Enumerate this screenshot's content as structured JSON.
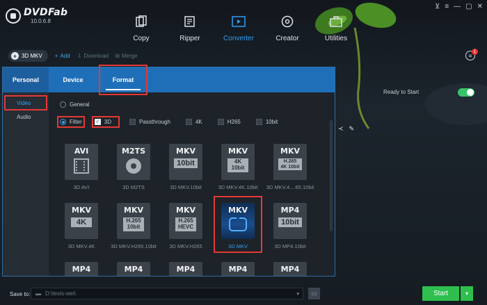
{
  "app": {
    "name": "DVDFab",
    "version": "10.0.6.8"
  },
  "window_controls": [
    "pin-icon",
    "menu-icon",
    "minimize-icon",
    "maximize-icon",
    "close-icon"
  ],
  "modules": [
    {
      "label": "Copy",
      "icon": "copy-icon"
    },
    {
      "label": "Ripper",
      "icon": "ripper-icon"
    },
    {
      "label": "Converter",
      "icon": "converter-icon",
      "active": true
    },
    {
      "label": "Creator",
      "icon": "creator-icon"
    },
    {
      "label": "Utilities",
      "icon": "utilities-icon"
    }
  ],
  "toolbar": {
    "mode": "3D MKV",
    "add": "Add",
    "download": "Download",
    "merge": "Merge"
  },
  "task_badge": "1",
  "background": {
    "ready_label": "Ready to Start"
  },
  "popup": {
    "tabs": {
      "personal": "Personal",
      "device": "Device",
      "format": "Format"
    },
    "side": {
      "video": "Video",
      "audio": "Audio"
    },
    "general": "General",
    "filter": "Filter",
    "options": {
      "three_d": "3D",
      "passthrough": "Passthrough",
      "four_k": "4K",
      "h265": "H265",
      "tenbit": "10bit"
    },
    "formats": [
      {
        "t1": "AVI",
        "cap": "3D AVI"
      },
      {
        "t1": "M2TS",
        "cap": "3D M2TS"
      },
      {
        "t1": "MKV",
        "t2": "10bit",
        "cap": "3D MKV.10bit"
      },
      {
        "t1": "MKV",
        "t2": "4K\n10bit",
        "cap": "3D MKV.4K.10bit"
      },
      {
        "t1": "MKV",
        "t2": "H.265\n4K 10bit",
        "cap": "3D MKV.4....65.10bit"
      },
      {
        "t1": "MKV",
        "t2": "4K",
        "cap": "3D MKV.4K"
      },
      {
        "t1": "MKV",
        "t2": "H.265\n10bit",
        "cap": "3D MKV.H265.10bit"
      },
      {
        "t1": "MKV",
        "t2": "H.265\nHEVC",
        "cap": "3D MKV.H265"
      },
      {
        "t1": "MKV",
        "cap": "3D MKV"
      },
      {
        "t1": "MP4",
        "t2": "10bit",
        "cap": "3D MP4.10bit"
      },
      {
        "t1": "MP4"
      },
      {
        "t1": "MP4"
      },
      {
        "t1": "MP4"
      },
      {
        "t1": "MP4"
      },
      {
        "t1": "MP4"
      }
    ]
  },
  "bottom": {
    "save_to": "Save to:",
    "path": "D:\\tests-wei\\",
    "start": "Start"
  },
  "colors": {
    "accent_blue": "#1f6fb8",
    "start_green": "#2ebf4f",
    "highlight_red": "#e53935",
    "toggle_green": "#36c46a"
  }
}
